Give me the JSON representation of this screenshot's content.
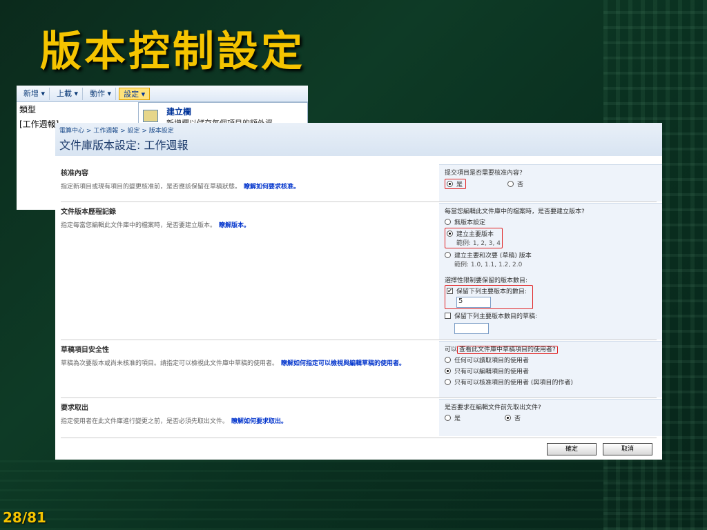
{
  "slide": {
    "title": "版本控制設定",
    "page": "28/81"
  },
  "back_window": {
    "toolbar": [
      "新增 ▾",
      "上載 ▾",
      "動作 ▾",
      "設定 ▾"
    ],
    "rows": [
      "類型",
      "[工作週報]"
    ],
    "menu": {
      "title": "建立欄",
      "desc": "新增欄以儲存每個項目的額外資"
    }
  },
  "window": {
    "breadcrumb": "電算中心 > 工作週報 > 設定 > 版本設定",
    "title": "文件庫版本設定: 工作週報",
    "sections": [
      {
        "heading": "核准內容",
        "desc": "指定新項目或現有項目的變更核准前，是否應該保留在草稿狀態。",
        "link": "瞭解如何要求核准。",
        "question": "提交項目是否需要核准內容?",
        "options": [
          "是",
          "否"
        ]
      },
      {
        "heading": "文件版本歷程記錄",
        "desc": "指定每當您編輯此文件庫中的檔案時，是否要建立版本。",
        "link": "瞭解版本。",
        "question": "每當您編輯此文件庫中的檔案時，是否要建立版本?",
        "opt_none": "無版本設定",
        "opt_major": "建立主要版本",
        "opt_major_ex": "範例: 1, 2, 3, 4",
        "opt_minor": "建立主要和次要 (草稿) 版本",
        "opt_minor_ex": "範例: 1.0, 1.1, 1.2, 2.0",
        "limit_label": "選擇性限制要保留的版本數目:",
        "keep_major": "保留下列主要版本的數目:",
        "keep_major_value": "5",
        "keep_drafts": "保留下列主要版本數目的草稿:"
      },
      {
        "heading": "草稿項目安全性",
        "desc": "草稿為次要版本或尚未核准的項目。請指定可以檢視此文件庫中草稿的使用者。",
        "link": "瞭解如何指定可以檢視與編輯草稿的使用者。",
        "question_a": "可以",
        "question_b": "查看此文件庫中草稿項目的使用者?",
        "options": [
          "任何可以讀取項目的使用者",
          "只有可以編輯項目的使用者",
          "只有可以核准項目的使用者 (與項目的作者)"
        ]
      },
      {
        "heading": "要求取出",
        "desc": "指定使用者在此文件庫進行變更之前，是否必須先取出文件。",
        "link": "瞭解如何要求取出。",
        "question": "是否要求在編輯文件前先取出文件?",
        "options": [
          "是",
          "否"
        ]
      }
    ],
    "ok": "確定",
    "cancel": "取消"
  }
}
